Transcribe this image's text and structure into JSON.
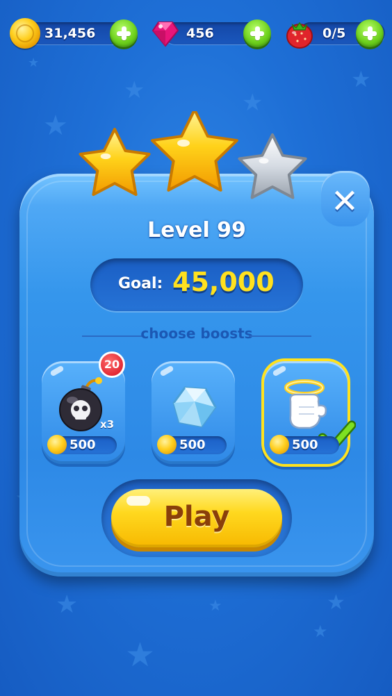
{
  "resources": {
    "coins": {
      "value": "31,456",
      "icon": "coin-icon"
    },
    "gems": {
      "value": "456",
      "icon": "gem-icon"
    },
    "lives": {
      "value": "0/5",
      "icon": "strawberry-icon"
    }
  },
  "rating": {
    "stars_earned": 2,
    "stars_total": 3
  },
  "panel": {
    "level_title": "Level 99",
    "goal_label": "Goal:",
    "goal_value": "45,000",
    "boosts_heading": "choose boosts",
    "close_icon": "close-icon"
  },
  "boosts": [
    {
      "name": "bomb",
      "icon": "bomb-icon",
      "badge": "20",
      "quantity": "x3",
      "price": "500",
      "selected": false
    },
    {
      "name": "crystal",
      "icon": "crystal-icon",
      "price": "500",
      "selected": false
    },
    {
      "name": "glove",
      "icon": "glove-icon",
      "price": "500",
      "selected": true
    }
  ],
  "play_button": {
    "label": "Play"
  },
  "colors": {
    "background": "#1e6fd6",
    "accent_yellow": "#ffd81f",
    "plus_green": "#6ed11d",
    "badge_red": "#d60f1f"
  }
}
